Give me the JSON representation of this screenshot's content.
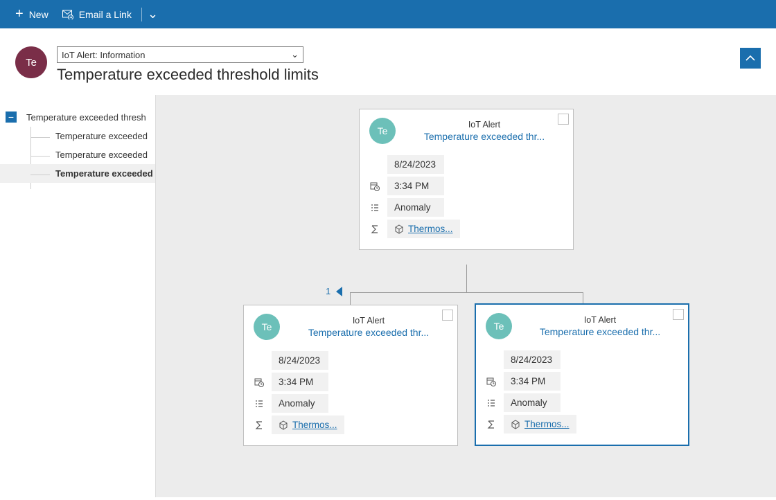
{
  "commandbar": {
    "new_label": "New",
    "email_link_label": "Email a Link"
  },
  "header": {
    "avatar_initials": "Te",
    "form_selector_label": "IoT Alert: Information",
    "title": "Temperature exceeded threshold limits"
  },
  "tree": {
    "root": {
      "label": "Temperature exceeded thresh"
    },
    "children": [
      {
        "label": "Temperature exceeded"
      },
      {
        "label": "Temperature exceeded"
      },
      {
        "label": "Temperature exceeded"
      }
    ]
  },
  "canvas": {
    "page_count_label": "1",
    "cards": [
      {
        "avatar": "Te",
        "type_label": "IoT Alert",
        "title": "Temperature exceeded thr...",
        "date": "8/24/2023",
        "time": "3:34 PM",
        "status": "Anomaly",
        "device": "Thermos..."
      },
      {
        "avatar": "Te",
        "type_label": "IoT Alert",
        "title": "Temperature exceeded thr...",
        "date": "8/24/2023",
        "time": "3:34 PM",
        "status": "Anomaly",
        "device": "Thermos..."
      },
      {
        "avatar": "Te",
        "type_label": "IoT Alert",
        "title": "Temperature exceeded thr...",
        "date": "8/24/2023",
        "time": "3:34 PM",
        "status": "Anomaly",
        "device": "Thermos..."
      }
    ]
  }
}
